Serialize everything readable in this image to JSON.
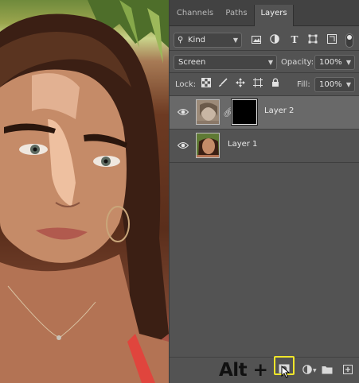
{
  "tabs": [
    {
      "label": "Channels",
      "active": false
    },
    {
      "label": "Paths",
      "active": false
    },
    {
      "label": "Layers",
      "active": true
    }
  ],
  "filter": {
    "kind_label": "Kind",
    "icons": [
      "image-filter-icon",
      "adjustment-filter-icon",
      "type-filter-icon",
      "shape-filter-icon",
      "smart-object-filter-icon"
    ]
  },
  "blend": {
    "mode": "Screen",
    "opacity_label": "Opacity:",
    "opacity_value": "100%"
  },
  "lock": {
    "label": "Lock:",
    "icons": [
      "lock-transparent-pixels-icon",
      "lock-image-pixels-icon",
      "lock-position-icon",
      "lock-artboard-icon",
      "lock-all-icon"
    ],
    "fill_label": "Fill:",
    "fill_value": "100%"
  },
  "layers": [
    {
      "name": "Layer 2",
      "visible": true,
      "selected": true,
      "has_mask": true
    },
    {
      "name": "Layer 1",
      "visible": true,
      "selected": false,
      "has_mask": false
    }
  ],
  "annotation": {
    "text": "Alt +",
    "highlight_color": "#f0e62a"
  },
  "bottom_icons": [
    "add-layer-mask-icon",
    "adjustment-layer-icon",
    "new-group-icon",
    "new-layer-icon"
  ]
}
